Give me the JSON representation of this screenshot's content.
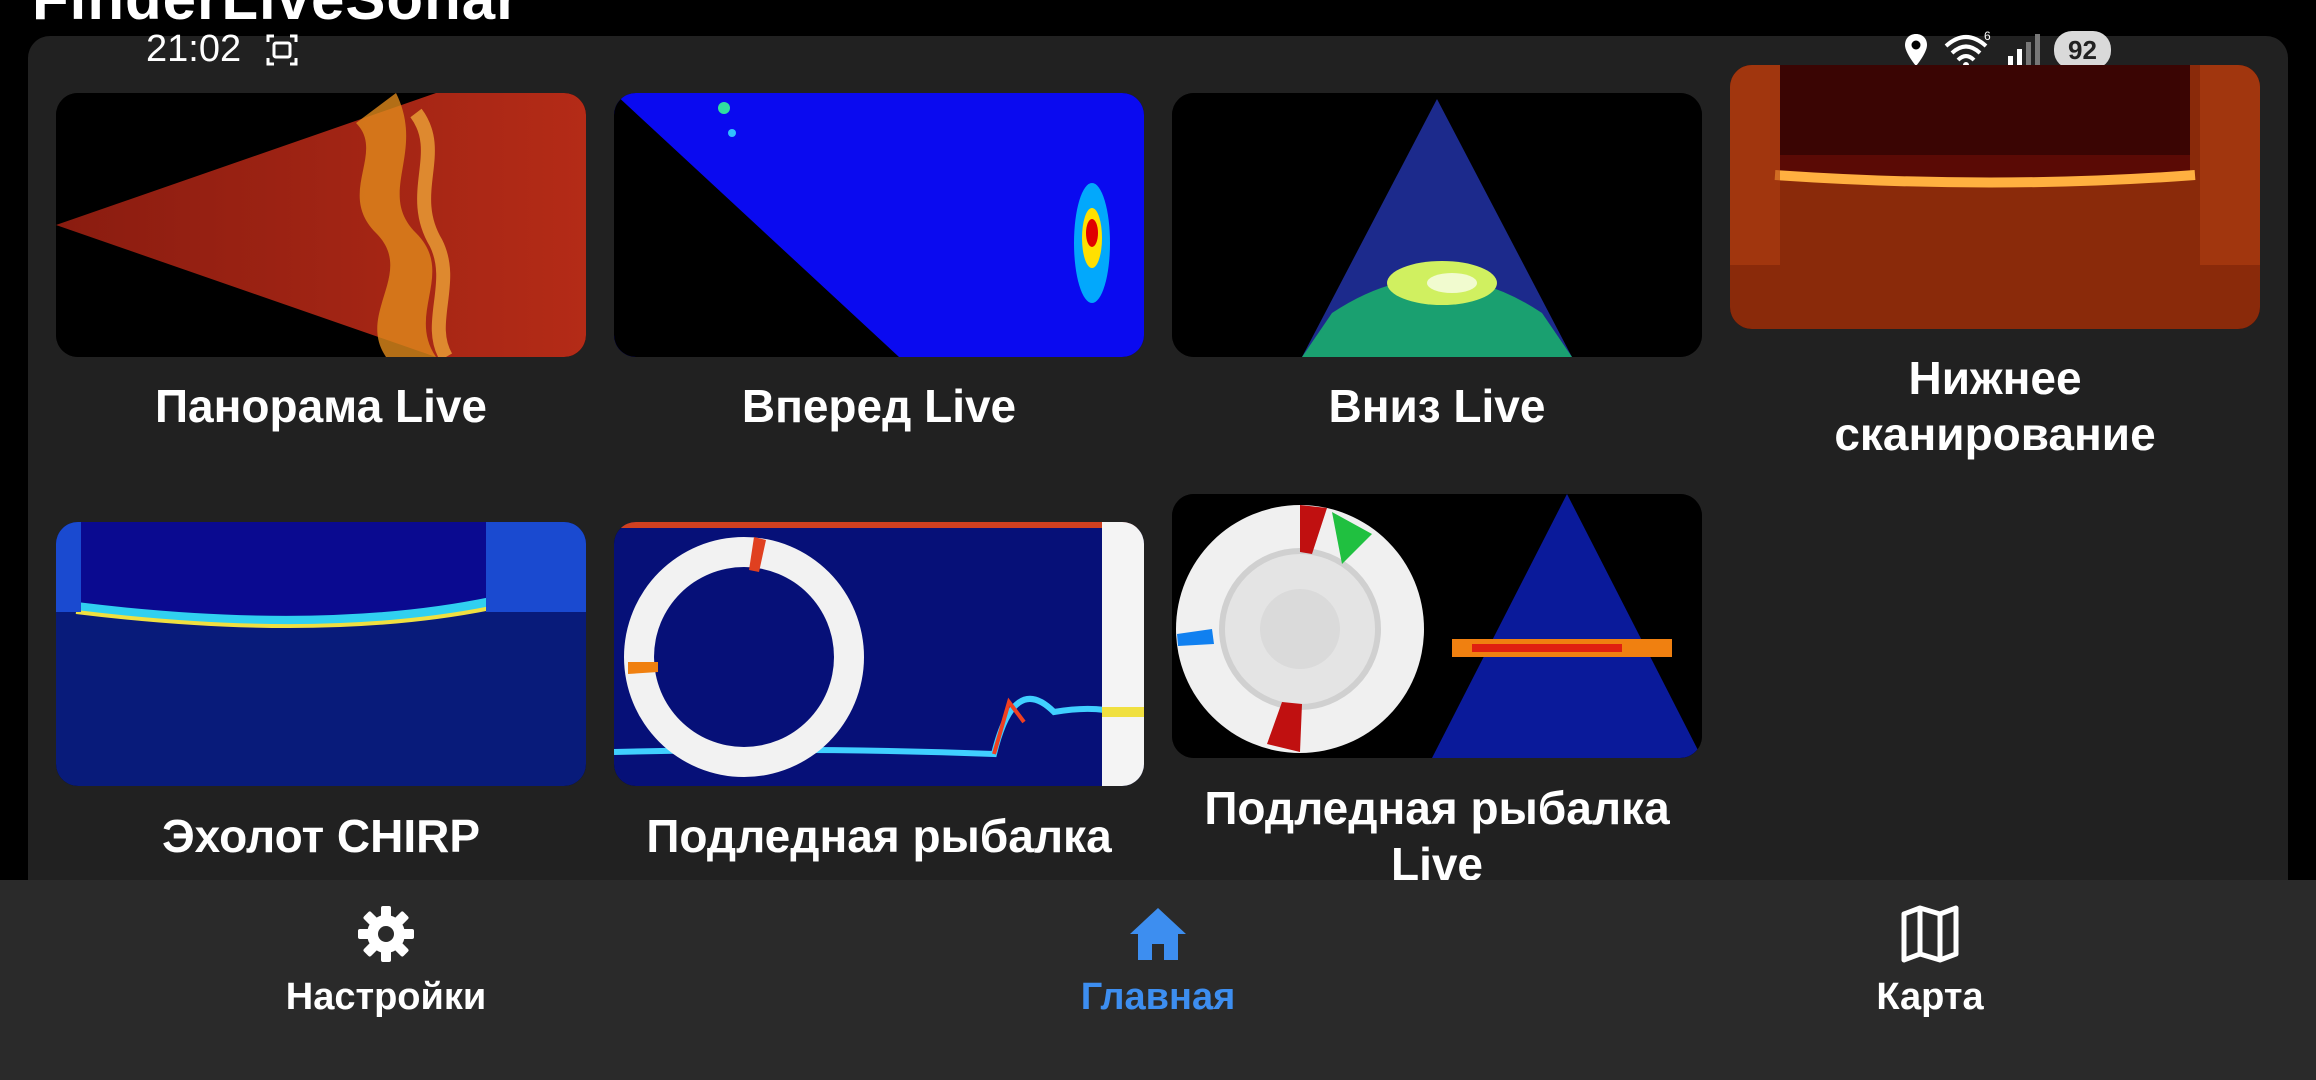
{
  "header": {
    "title": "FinderLiveSonar"
  },
  "status_bar": {
    "time": "21:02",
    "battery": "92",
    "icons": [
      "screenshot-icon",
      "location-icon",
      "wifi-icon",
      "signal-icon"
    ]
  },
  "modes": [
    {
      "label": "Панорама Live"
    },
    {
      "label": "Вперед Live"
    },
    {
      "label": "Вниз Live"
    },
    {
      "label_line1": "Нижнее",
      "label_line2": "сканирование"
    },
    {
      "label": "Эхолот CHIRP"
    },
    {
      "label": "Подледная рыбалка"
    },
    {
      "label_line1": "Подледная рыбалка",
      "label_line2": "Live"
    }
  ],
  "nav": {
    "settings_label": "Настройки",
    "home_label": "Главная",
    "map_label": "Карта",
    "active": "home",
    "active_color": "#3d8ef0"
  }
}
